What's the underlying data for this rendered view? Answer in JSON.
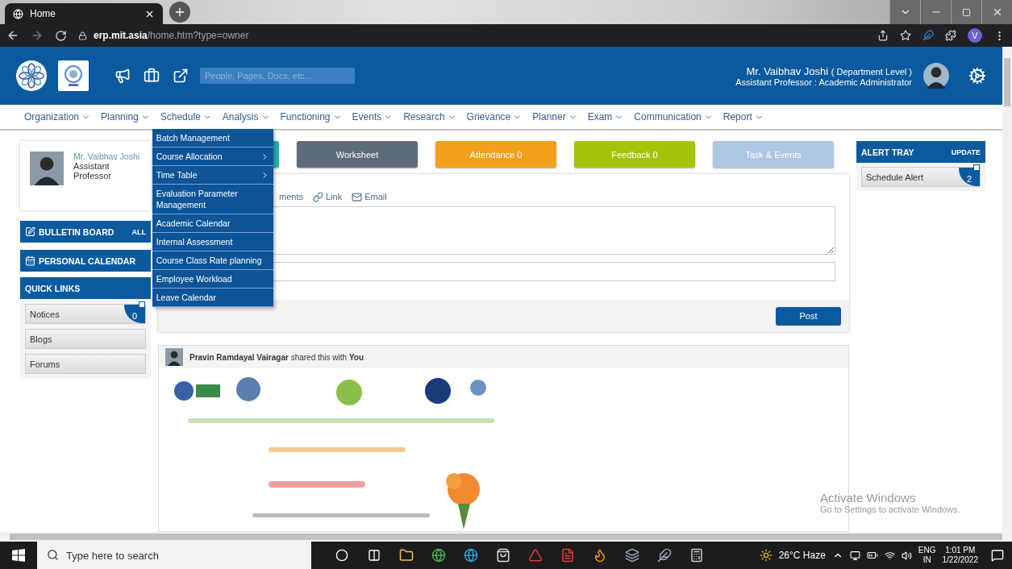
{
  "browser": {
    "tab_title": "Home",
    "url_host": "erp.mit.asia",
    "url_path": "/home.htm?type=owner",
    "profile_initial": "V"
  },
  "header": {
    "search_placeholder": "People, Pages, Docs, etc...",
    "user_name": "Mr. Vaibhav Joshi",
    "user_level": "( Department Level )",
    "user_role": "Assistant Professor : Academic Administrator"
  },
  "nav": [
    {
      "label": "Organization"
    },
    {
      "label": "Planning"
    },
    {
      "label": "Schedule",
      "menu": [
        {
          "label": "Batch Management",
          "has_submenu": false
        },
        {
          "label": "Course Allocation",
          "has_submenu": true
        },
        {
          "label": "Time Table",
          "has_submenu": true
        },
        {
          "label": "Evaluation Parameter Management",
          "has_submenu": false
        },
        {
          "label": "Academic Calendar",
          "has_submenu": false
        },
        {
          "label": "Internal Assessment",
          "has_submenu": false
        },
        {
          "label": "Course Class Rate planning",
          "has_submenu": false
        },
        {
          "label": "Employee Workload",
          "has_submenu": false
        },
        {
          "label": "Leave Calendar",
          "has_submenu": false
        }
      ]
    },
    {
      "label": "Analysis"
    },
    {
      "label": "Functioning"
    },
    {
      "label": "Events"
    },
    {
      "label": "Research"
    },
    {
      "label": "Grievance"
    },
    {
      "label": "Planner"
    },
    {
      "label": "Exam"
    },
    {
      "label": "Communication"
    },
    {
      "label": "Report"
    }
  ],
  "profile": {
    "name": "Mr. Vaibhav Joshi",
    "title": "Assistant Professor"
  },
  "bulletin_board": {
    "title": "BULLETIN BOARD",
    "action": "ALL"
  },
  "personal_calendar": {
    "title": "PERSONAL CALENDAR"
  },
  "quick_links": {
    "title": "QUICK LINKS",
    "items": [
      {
        "label": "Notices",
        "badge": "0"
      },
      {
        "label": "Blogs"
      },
      {
        "label": "Forums"
      }
    ]
  },
  "action_buttons": [
    {
      "color": "#1fb5a8"
    },
    {
      "label": "Worksheet",
      "color": "#5e6b78"
    },
    {
      "label": "Attendance 0",
      "color": "#f0a01a"
    },
    {
      "label": "Feedback 0",
      "color": "#a3c40a"
    },
    {
      "label": "Task & Events",
      "color": "#adc6e2"
    }
  ],
  "composer": {
    "tools": [
      {
        "kind": "text",
        "label": "ments"
      },
      {
        "kind": "link",
        "label": "Link"
      },
      {
        "kind": "email",
        "label": "Email"
      }
    ],
    "post_button": "Post"
  },
  "feed_post": {
    "text": "**Pravin Ramdayal Vairagar** shared this with **You**"
  },
  "alert_tray": {
    "title": "ALERT TRAY",
    "action": "UPDATE",
    "items": [
      {
        "label": "Schedule Alert",
        "badge": "2"
      }
    ]
  },
  "os_notice": {
    "title": "Activate Windows",
    "text": "Go to Settings to activate Windows."
  },
  "taskbar": {
    "search_placeholder": "Type here to search",
    "weather": "26°C Haze",
    "language": "ENG",
    "region": "IN",
    "time": "1:01 PM",
    "date": "1/22/2022"
  }
}
